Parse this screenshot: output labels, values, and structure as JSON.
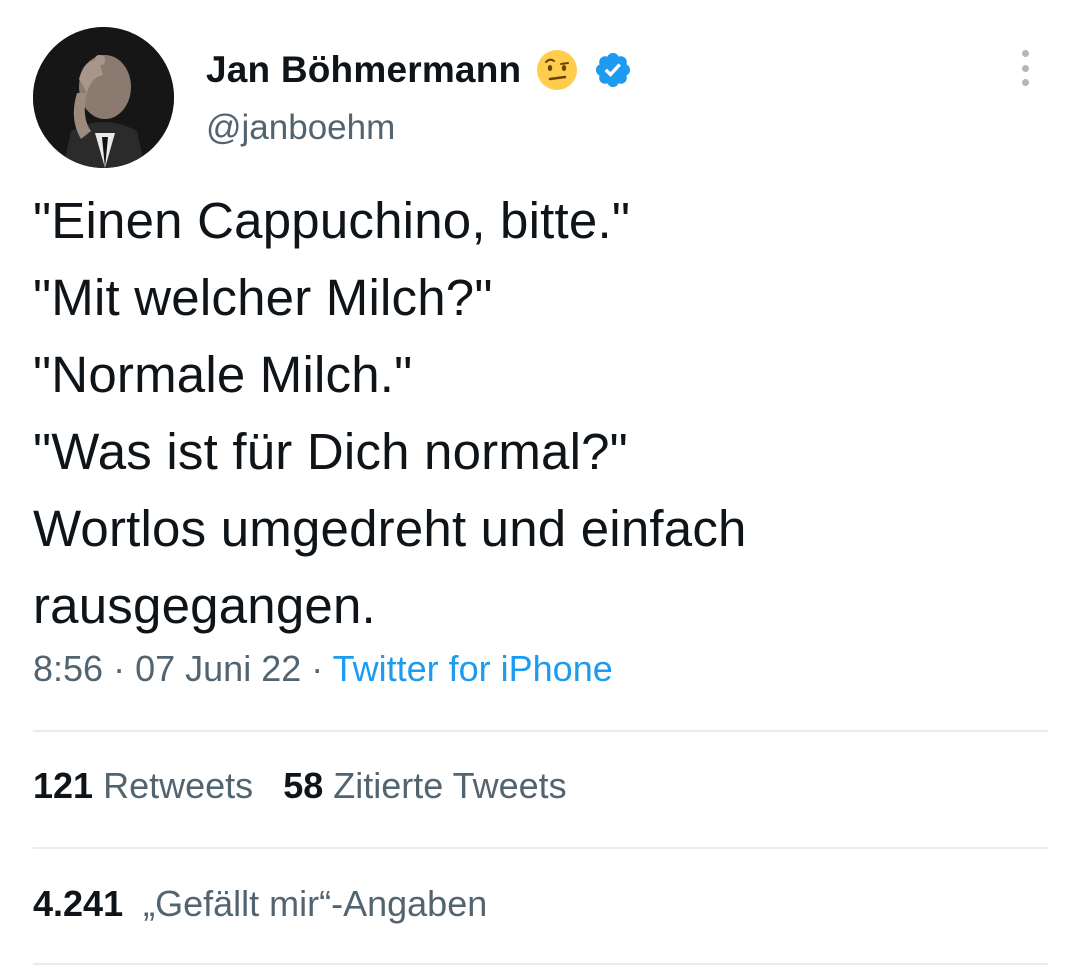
{
  "author": {
    "display_name": "Jan Böhmermann",
    "handle": "@janboehm",
    "emoji_icon": "face-with-raised-eyebrow-icon",
    "verified_icon": "verified-badge-icon",
    "verified_color": "#1d9bf0"
  },
  "tweet": {
    "lines": [
      "\"Einen Cappuchino, bitte.\"",
      "\"Mit welcher Milch?\"",
      "\"Normale Milch.\"",
      "\"Was ist für Dich normal?\"",
      "Wortlos umgedreht und einfach",
      "rausgegangen."
    ]
  },
  "meta": {
    "time": "8:56",
    "separator": "·",
    "date": "07 Juni 22",
    "source": "Twitter for iPhone",
    "source_color": "#1d9bf0"
  },
  "stats": {
    "retweets_count": "121",
    "retweets_label": "Retweets",
    "quotes_count": "58",
    "quotes_label": "Zitierte Tweets",
    "likes_count": "4.241",
    "likes_label": "„Gefällt mir“-Angaben"
  }
}
